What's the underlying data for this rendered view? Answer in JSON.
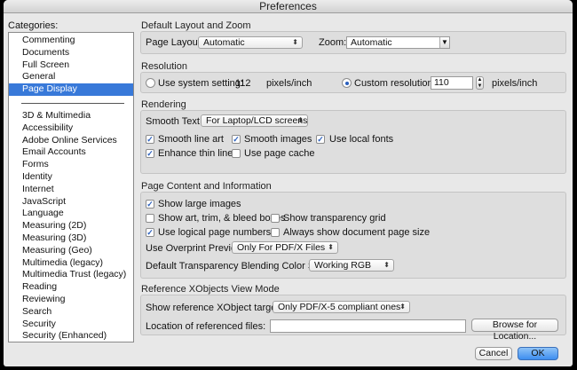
{
  "window": {
    "title": "Preferences"
  },
  "categories": {
    "label": "Categories:",
    "items_top": [
      "Commenting",
      "Documents",
      "Full Screen",
      "General",
      "Page Display"
    ],
    "selected": "Page Display",
    "items_bottom": [
      "3D & Multimedia",
      "Accessibility",
      "Adobe Online Services",
      "Email Accounts",
      "Forms",
      "Identity",
      "Internet",
      "JavaScript",
      "Language",
      "Measuring (2D)",
      "Measuring (3D)",
      "Measuring (Geo)",
      "Multimedia (legacy)",
      "Multimedia Trust (legacy)",
      "Reading",
      "Reviewing",
      "Search",
      "Security",
      "Security (Enhanced)"
    ]
  },
  "layout_zoom": {
    "title": "Default Layout and Zoom",
    "page_layout_label": "Page Layout:",
    "page_layout_value": "Automatic",
    "zoom_label": "Zoom:",
    "zoom_value": "Automatic"
  },
  "resolution": {
    "title": "Resolution",
    "system_label": "Use system setting:",
    "system_value": "112",
    "system_unit": "pixels/inch",
    "custom_label": "Custom resolution:",
    "custom_value": "110",
    "custom_unit": "pixels/inch",
    "selected": "custom"
  },
  "rendering": {
    "title": "Rendering",
    "smooth_text_label": "Smooth Text:",
    "smooth_text_value": "For Laptop/LCD screens",
    "smooth_line_art": {
      "label": "Smooth line art",
      "checked": true
    },
    "smooth_images": {
      "label": "Smooth images",
      "checked": true
    },
    "local_fonts": {
      "label": "Use local fonts",
      "checked": true
    },
    "enhance_thin_lines": {
      "label": "Enhance thin lines",
      "checked": true
    },
    "page_cache": {
      "label": "Use page cache",
      "checked": false
    }
  },
  "page_content": {
    "title": "Page Content and Information",
    "large_images": {
      "label": "Show large images",
      "checked": true
    },
    "art_trim": {
      "label": "Show art, trim, & bleed boxes",
      "checked": false
    },
    "transparency_grid": {
      "label": "Show transparency grid",
      "checked": false
    },
    "logical_page_numbers": {
      "label": "Use logical page numbers",
      "checked": true
    },
    "doc_page_size": {
      "label": "Always show document page size",
      "checked": false
    },
    "overprint_label": "Use Overprint Preview:",
    "overprint_value": "Only For PDF/X Files",
    "blending_label": "Default Transparency Blending Color Space:",
    "blending_value": "Working RGB"
  },
  "xobjects": {
    "title": "Reference XObjects View Mode",
    "targets_label": "Show reference XObject targets:",
    "targets_value": "Only PDF/X-5 compliant ones",
    "location_label": "Location of referenced files:",
    "location_value": "",
    "browse_label": "Browse for Location..."
  },
  "buttons": {
    "cancel": "Cancel",
    "ok": "OK"
  },
  "colors": {
    "selection": "#3879d9",
    "window_bg": "#e8e8e8",
    "default_button": "#3d8ef0"
  }
}
